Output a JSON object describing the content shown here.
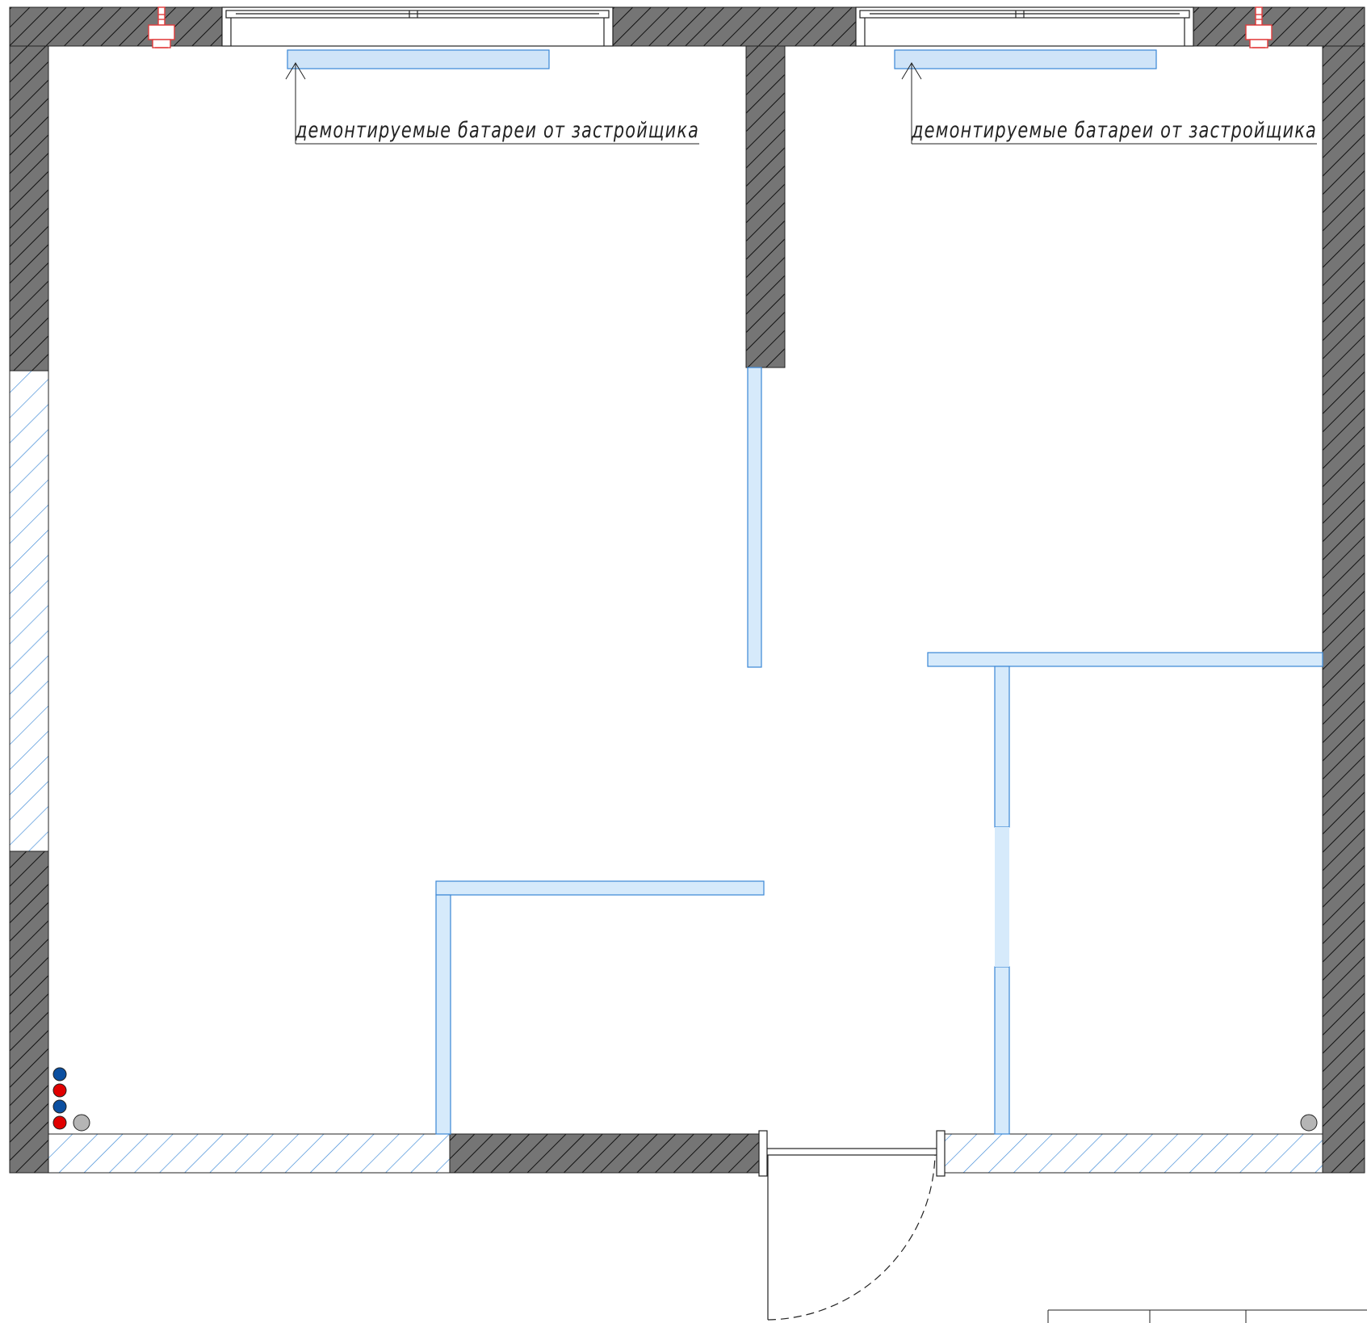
{
  "plan": {
    "colors": {
      "background": "#ffffff",
      "bearing_wall_fill": "#757575",
      "wall_hatch": "#111111",
      "partition_fill": "#d6eafb",
      "partition_stroke": "#3a87d6",
      "brick_hatch": "#3a87d6",
      "outline": "#222222",
      "radiator_fill": "#cfe4f8",
      "sink_stroke": "#e23a3a",
      "pipe_cold": "#0b4fa0",
      "pipe_hot": "#e00000",
      "pipe_sewer": "#b5b5b5"
    },
    "annotations": [
      {
        "text": "демонтируемые батареи от застройщика"
      },
      {
        "text": "демонтируемые батареи от застройщика"
      }
    ],
    "icons": {
      "window": "window-icon",
      "radiator": "radiator-icon",
      "sink": "sink-fixture-icon",
      "riser": "riser-pipe-icon",
      "door": "entrance-door-icon"
    }
  }
}
